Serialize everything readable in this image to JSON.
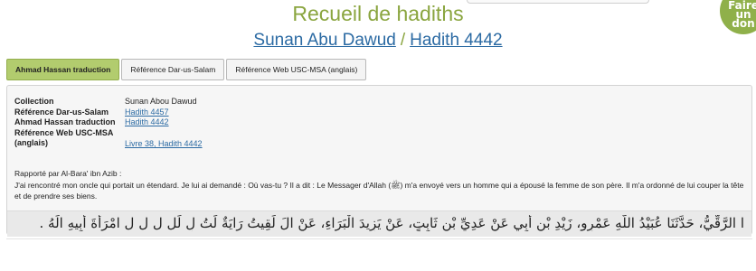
{
  "header": {
    "title": "Recueil de hadiths",
    "collection_link": "Sunan Abu Dawud",
    "separator": "/",
    "hadith_link": "Hadith 4442",
    "donate_lines": [
      "Faire",
      "un",
      "don"
    ]
  },
  "tabs": [
    {
      "label": "Ahmad Hassan traduction",
      "active": true
    },
    {
      "label": "Référence Dar-us-Salam",
      "active": false
    },
    {
      "label": "Référence Web USC-MSA (anglais)",
      "active": false
    }
  ],
  "info": {
    "collection_key": "Collection",
    "collection_val": "Sunan Abou Dawud",
    "darussalam_key": "Référence Dar-us-Salam",
    "darussalam_val": "Hadith 4457",
    "ahmad_key": "Ahmad Hassan traduction",
    "ahmad_val": "Hadith 4442",
    "usc_key1": "Référence Web USC-MSA",
    "usc_key2": "(anglais)",
    "usc_val": "Livre 38, Hadith 4442"
  },
  "narrator": "Rapporté par Al-Bara' ibn Azib :",
  "translation": "J'ai rencontré mon oncle qui portait un étendard. Je lui ai demandé : Où vas-tu ? Il a dit : Le Messager d'Allah (ﷺ) m'a envoyé vers un homme qui a épousé la femme de son père. Il m'a ordonné de lui couper la tête et de prendre ses biens.",
  "arabic": "ا الرَّقِّيُّ، حَدَّثَنَا عُبَيْدُ اللَّهِ عَمْرٍو، زَيْدِ بْنِ أَبِي عَنْ عَدِيِّ بْنِ ثَابِتٍ، عَنْ يَزِيدَ الْبَرَاءِ، عَنْ الَ لَقِيتُ رَايَةٌ لَتُ لِ لَل ل ل ل امْرَأَةَ أَبِيهِ الَهُ .",
  "colors": {
    "title_green": "#8aa53f",
    "link_blue": "#2b6aa3",
    "active_tab": "#b2cc6e",
    "panel_bg": "#f6f6f6",
    "arabic_bg": "#e9e9e9"
  }
}
